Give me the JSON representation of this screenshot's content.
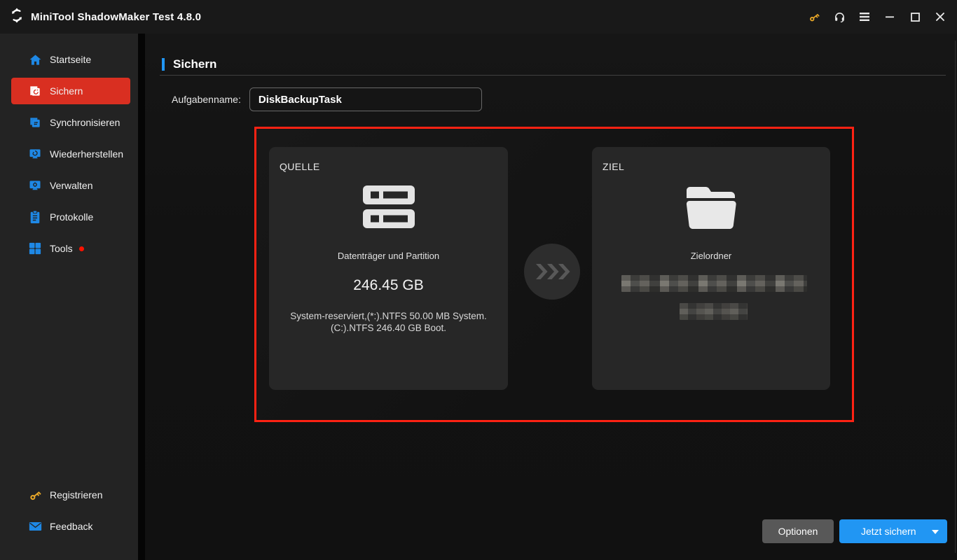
{
  "window": {
    "title": "MiniTool ShadowMaker Test 4.8.0"
  },
  "sidebar": {
    "items": [
      {
        "label": "Startseite",
        "icon": "home-icon",
        "active": false
      },
      {
        "label": "Sichern",
        "icon": "backup-icon",
        "active": true
      },
      {
        "label": "Synchronisieren",
        "icon": "sync-icon",
        "active": false
      },
      {
        "label": "Wiederherstellen",
        "icon": "restore-icon",
        "active": false
      },
      {
        "label": "Verwalten",
        "icon": "manage-icon",
        "active": false
      },
      {
        "label": "Protokolle",
        "icon": "logs-icon",
        "active": false
      },
      {
        "label": "Tools",
        "icon": "tools-icon",
        "active": false,
        "badge": "red-dot"
      }
    ],
    "footer_items": [
      {
        "label": "Registrieren",
        "icon": "key-icon"
      },
      {
        "label": "Feedback",
        "icon": "mail-icon"
      }
    ]
  },
  "main": {
    "page_title": "Sichern",
    "task_name_label": "Aufgabenname:",
    "task_name_value": "DiskBackupTask",
    "source_card": {
      "title": "QUELLE",
      "icon": "disk-icon",
      "type_label": "Datenträger und Partition",
      "size": "246.45 GB",
      "detail_line1": "System-reserviert,(*:).NTFS 50.00 MB System.",
      "detail_line2": "(C:).NTFS 246.40 GB Boot."
    },
    "dest_card": {
      "title": "ZIEL",
      "icon": "folder-icon",
      "type_label": "Zielordner",
      "path_redacted": true
    }
  },
  "footer": {
    "options_label": "Optionen",
    "backup_now_label": "Jetzt sichern"
  },
  "colors": {
    "active_red": "#d92f21",
    "highlight_red": "#ff2213",
    "accent_blue": "#2196f3",
    "icon_blue": "#1e88e5",
    "key_gold": "#e8a728"
  }
}
